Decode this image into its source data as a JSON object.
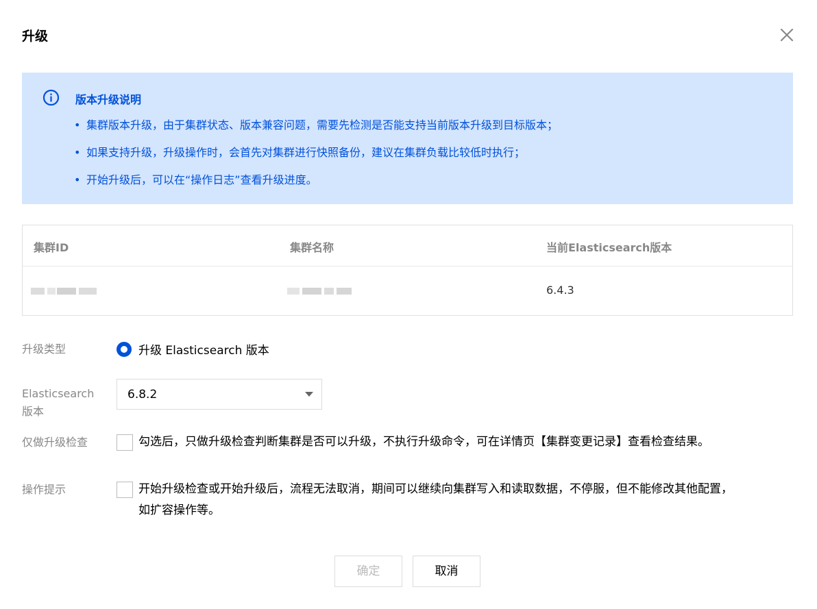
{
  "dialog": {
    "title": "升级"
  },
  "notice": {
    "title": "版本升级说明",
    "bullet": "•",
    "items": [
      "集群版本升级，由于集群状态、版本兼容问题，需要先检测是否能支持当前版本升级到目标版本；",
      "如果支持升级，升级操作时，会首先对集群进行快照备份，建议在集群负载比较低时执行；",
      "开始升级后，可以在“操作日志”查看升级进度。"
    ],
    "color": "#0052d9",
    "background": "#d4e5fe"
  },
  "table": {
    "headers": [
      "集群ID",
      "集群名称",
      "当前Elasticsearch版本"
    ],
    "row": {
      "cluster_id": "",
      "cluster_name": "",
      "current_version": "6.4.3"
    }
  },
  "form": {
    "upgrade_type": {
      "label": "升级类型",
      "option": "升级 Elasticsearch 版本",
      "selected": true
    },
    "es_version": {
      "label_line1": "Elasticsearch",
      "label_line2": "版本",
      "value": "6.8.2"
    },
    "check_only": {
      "label": "仅做升级检查",
      "text": "勾选后，只做升级检查判断集群是否可以升级，不执行升级命令，可在详情页【集群变更记录】查看检查结果。",
      "checked": false
    },
    "operation_tip": {
      "label": "操作提示",
      "text_line1": "开始升级检查或开始升级后，流程无法取消，期间可以继续向集群写入和读取数据，不停服，但不能修改其他配置，",
      "text_line2": "如扩容操作等。",
      "checked": false
    }
  },
  "buttons": {
    "ok": "确定",
    "cancel": "取消"
  }
}
